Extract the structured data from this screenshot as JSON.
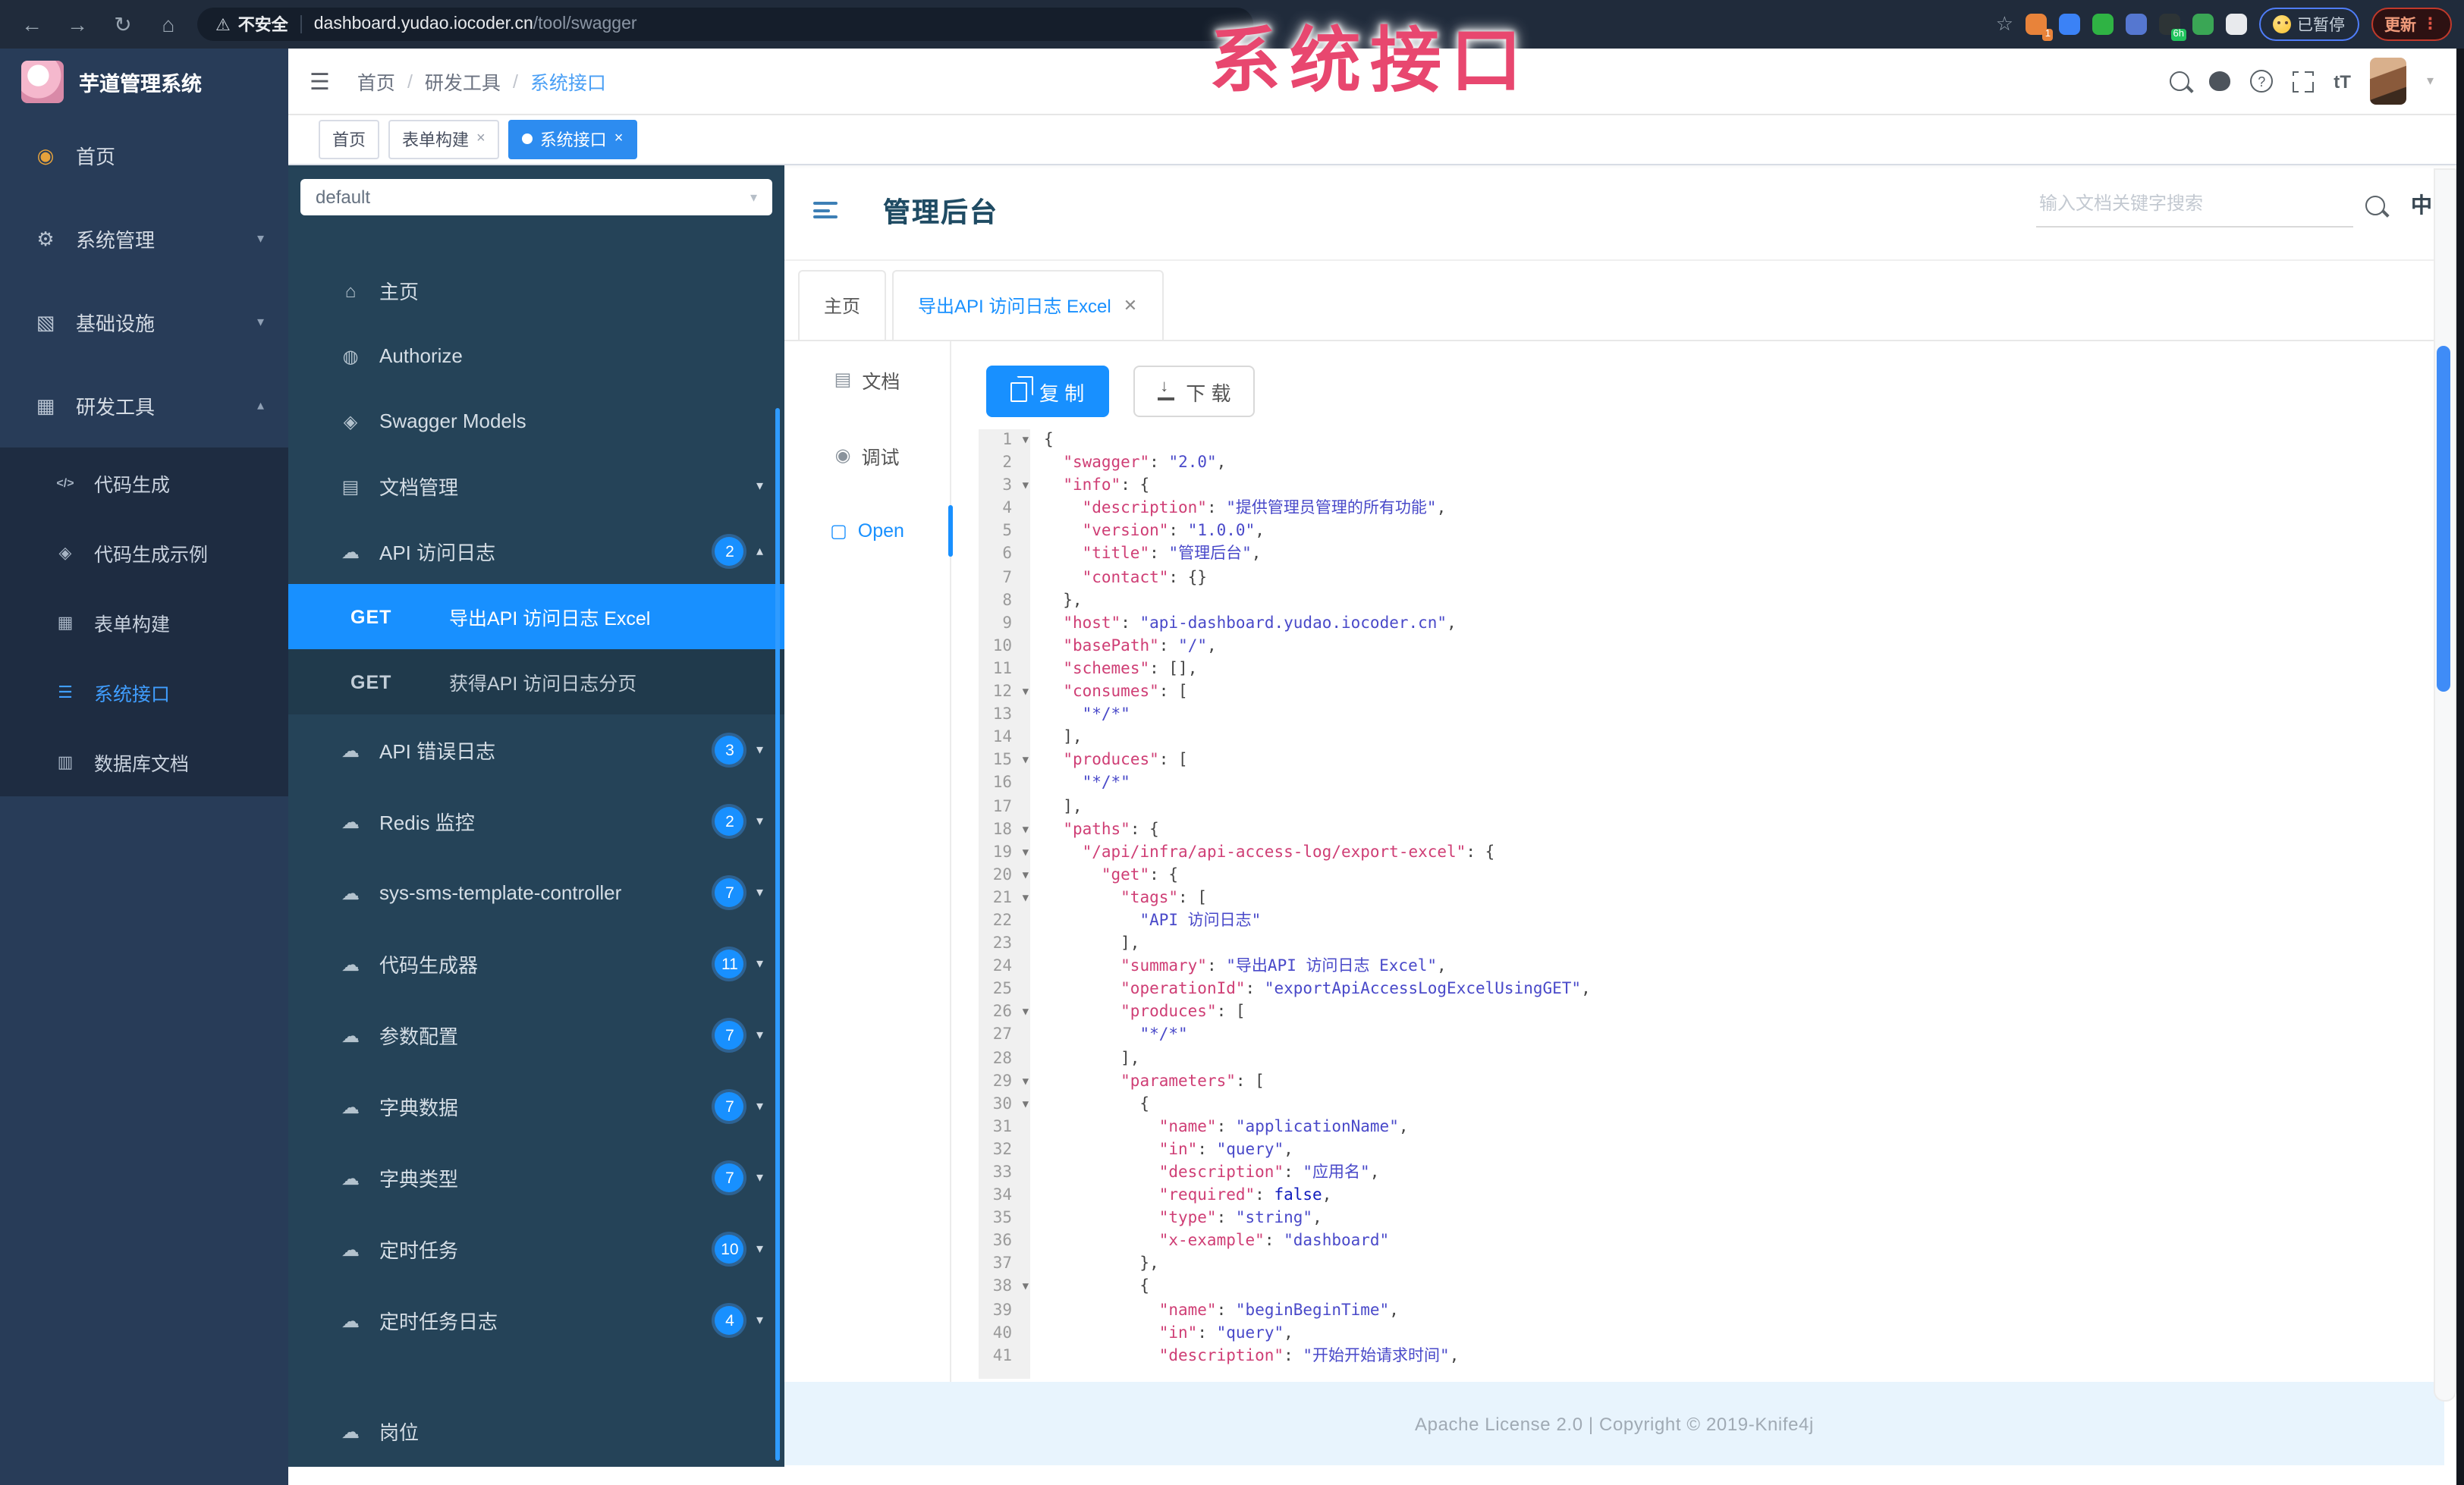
{
  "browser": {
    "back_icon": "←",
    "forward_icon": "→",
    "reload_icon": "↻",
    "home_icon": "⌂",
    "warning_icon": "⚠",
    "security_label": "不安全",
    "url_host": "dashboard.yudao.iocoder.cn",
    "url_path": "/tool/swagger",
    "bookmark_icon": "☆",
    "extensions": [
      {
        "name": "extension-orange",
        "color": "#e8833a",
        "badge": "1"
      },
      {
        "name": "extension-blue-drop",
        "color": "#3b82f6",
        "badge": ""
      },
      {
        "name": "extension-green-circle",
        "color": "#2fb344",
        "badge": ""
      },
      {
        "name": "extension-blue-grid",
        "color": "#5577d0",
        "badge": ""
      },
      {
        "name": "extension-dark",
        "color": "#2d3436",
        "badge": "6h"
      },
      {
        "name": "extension-green-leaf",
        "color": "#3aa655",
        "badge": ""
      },
      {
        "name": "extension-white-star",
        "color": "#e8eaed",
        "badge": ""
      }
    ],
    "paused_label": "已暂停",
    "update_label": "更新",
    "menu_dots": "⋮"
  },
  "watermark": "系统接口",
  "logo": {
    "title": "芋道管理系统"
  },
  "breadcrumb": {
    "items": [
      "首页",
      "研发工具",
      "系统接口"
    ],
    "separator": "/"
  },
  "view_tags": [
    {
      "label": "首页",
      "closable": false,
      "active": false
    },
    {
      "label": "表单构建",
      "closable": true,
      "active": false
    },
    {
      "label": "系统接口",
      "closable": true,
      "active": true
    }
  ],
  "sidebar": {
    "items": [
      {
        "label": "首页",
        "icon": "dashboard",
        "chevron": ""
      },
      {
        "label": "系统管理",
        "icon": "gear",
        "chevron": "down"
      },
      {
        "label": "基础设施",
        "icon": "infra",
        "chevron": "down"
      },
      {
        "label": "研发工具",
        "icon": "tools",
        "chevron": "up"
      }
    ],
    "sub_items": [
      {
        "label": "代码生成",
        "icon": "code",
        "active": false
      },
      {
        "label": "代码生成示例",
        "icon": "example",
        "active": false
      },
      {
        "label": "表单构建",
        "icon": "form",
        "active": false
      },
      {
        "label": "系统接口",
        "icon": "api",
        "active": true
      },
      {
        "label": "数据库文档",
        "icon": "db",
        "active": false
      }
    ]
  },
  "k4": {
    "group_value": "default",
    "nav_items": [
      {
        "label": "主页",
        "icon": "home",
        "badge": "",
        "chevron": ""
      },
      {
        "label": "Authorize",
        "icon": "lock",
        "badge": "",
        "chevron": ""
      },
      {
        "label": "Swagger Models",
        "icon": "models",
        "badge": "",
        "chevron": ""
      },
      {
        "label": "文档管理",
        "icon": "docs",
        "badge": "",
        "chevron": "down"
      },
      {
        "label": "API 访问日志",
        "icon": "cloud",
        "badge": "2",
        "chevron": "up"
      }
    ],
    "operations": [
      {
        "method": "GET",
        "label": "导出API 访问日志 Excel",
        "active": true
      },
      {
        "method": "GET",
        "label": "获得API 访问日志分页",
        "active": false
      }
    ],
    "tag_items": [
      {
        "label": "API 错误日志",
        "icon": "cloud",
        "badge": "3"
      },
      {
        "label": "Redis 监控",
        "icon": "cloud",
        "badge": "2"
      },
      {
        "label": "sys-sms-template-controller",
        "icon": "cloud",
        "badge": "7"
      },
      {
        "label": "代码生成器",
        "icon": "cloud",
        "badge": "11"
      },
      {
        "label": "参数配置",
        "icon": "cloud",
        "badge": "7"
      },
      {
        "label": "字典数据",
        "icon": "cloud",
        "badge": "7"
      },
      {
        "label": "字典类型",
        "icon": "cloud",
        "badge": "7"
      },
      {
        "label": "定时任务",
        "icon": "cloud",
        "badge": "10"
      },
      {
        "label": "定时任务日志",
        "icon": "cloud",
        "badge": "4"
      },
      {
        "label": "岗位",
        "icon": "cloud",
        "badge": "",
        "partial": true
      }
    ]
  },
  "doc": {
    "title": "管理后台",
    "search_placeholder": "输入文档关键字搜索",
    "lang_toggle": "中",
    "tabs": [
      {
        "label": "主页",
        "active": false,
        "closable": false
      },
      {
        "label": "导出API 访问日志 Excel",
        "active": true,
        "closable": true
      }
    ],
    "side_tabs": [
      {
        "label": "文档",
        "icon": "doc",
        "active": false
      },
      {
        "label": "调试",
        "icon": "debug",
        "active": false
      },
      {
        "label": "Open",
        "icon": "open",
        "active": true
      }
    ],
    "copy_button": "复 制",
    "download_button": "下 载"
  },
  "code": {
    "fold_lines": [
      1,
      3,
      12,
      15,
      18,
      19,
      20,
      21,
      26,
      29,
      30,
      38
    ],
    "lines": [
      "{",
      "  \"swagger\": \"2.0\",",
      "  \"info\": {",
      "    \"description\": \"提供管理员管理的所有功能\",",
      "    \"version\": \"1.0.0\",",
      "    \"title\": \"管理后台\",",
      "    \"contact\": {}",
      "  },",
      "  \"host\": \"api-dashboard.yudao.iocoder.cn\",",
      "  \"basePath\": \"/\",",
      "  \"schemes\": [],",
      "  \"consumes\": [",
      "    \"*/*\"",
      "  ],",
      "  \"produces\": [",
      "    \"*/*\"",
      "  ],",
      "  \"paths\": {",
      "    \"/api/infra/api-access-log/export-excel\": {",
      "      \"get\": {",
      "        \"tags\": [",
      "          \"API 访问日志\"",
      "        ],",
      "        \"summary\": \"导出API 访问日志 Excel\",",
      "        \"operationId\": \"exportApiAccessLogExcelUsingGET\",",
      "        \"produces\": [",
      "          \"*/*\"",
      "        ],",
      "        \"parameters\": [",
      "          {",
      "            \"name\": \"applicationName\",",
      "            \"in\": \"query\",",
      "            \"description\": \"应用名\",",
      "            \"required\": false,",
      "            \"type\": \"string\",",
      "            \"x-example\": \"dashboard\"",
      "          },",
      "          {",
      "            \"name\": \"beginBeginTime\",",
      "            \"in\": \"query\",",
      "            \"description\": \"开始开始请求时间\","
    ]
  },
  "footer": {
    "text": "Apache License 2.0 | Copyright © 2019-Knife4j"
  }
}
